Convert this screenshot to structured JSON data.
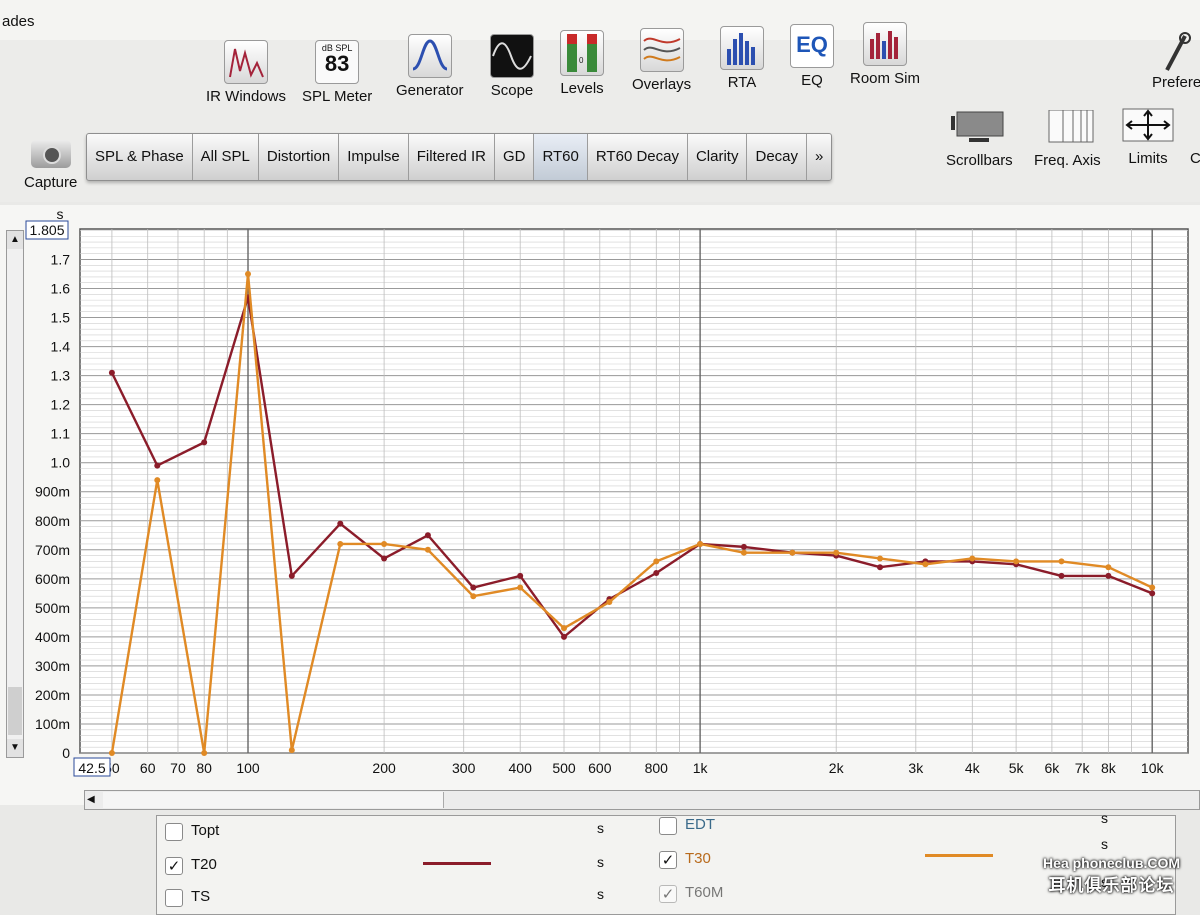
{
  "window": {
    "title_fragment": "ades"
  },
  "toolbar": {
    "items": [
      {
        "label": "IR Windows",
        "icon": "ir-windows-icon"
      },
      {
        "label": "SPL Meter",
        "icon": "spl-meter-icon",
        "meter_unit": "dB SPL",
        "meter_value": "83"
      },
      {
        "label": "Generator",
        "icon": "generator-icon"
      },
      {
        "label": "Scope",
        "icon": "scope-icon"
      },
      {
        "label": "Levels",
        "icon": "levels-icon"
      },
      {
        "label": "Overlays",
        "icon": "overlays-icon"
      },
      {
        "label": "RTA",
        "icon": "rta-icon"
      },
      {
        "label": "EQ",
        "icon": "eq-icon"
      },
      {
        "label": "Room Sim",
        "icon": "room-sim-icon"
      }
    ],
    "preferences_label": "Prefere",
    "capture_label": "Capture"
  },
  "tabs": {
    "items": [
      "SPL & Phase",
      "All SPL",
      "Distortion",
      "Impulse",
      "Filtered IR",
      "GD",
      "RT60",
      "RT60 Decay",
      "Clarity",
      "Decay",
      "»"
    ],
    "active": "RT60"
  },
  "right_tools": [
    {
      "label": "Scrollbars",
      "icon": "scrollbars-icon"
    },
    {
      "label": "Freq. Axis",
      "icon": "freq-axis-icon"
    },
    {
      "label": "Limits",
      "icon": "limits-icon"
    },
    {
      "label": "C",
      "icon": ""
    }
  ],
  "colors": {
    "t20": "#8b1c2a",
    "t30": "#e08a25",
    "accent": "#2a4a9a"
  },
  "chart_data": {
    "type": "line",
    "xscale": "log",
    "xlim": [
      42.5,
      12000
    ],
    "ylim": [
      0,
      1.805
    ],
    "yunit": "s",
    "ymax_label": "1.805",
    "xmin_label": "42.5",
    "x_ticks": [
      {
        "v": 50,
        "l": "50"
      },
      {
        "v": 60,
        "l": "60"
      },
      {
        "v": 70,
        "l": "70"
      },
      {
        "v": 80,
        "l": "80"
      },
      {
        "v": 100,
        "l": "100"
      },
      {
        "v": 200,
        "l": "200"
      },
      {
        "v": 300,
        "l": "300"
      },
      {
        "v": 400,
        "l": "400"
      },
      {
        "v": 500,
        "l": "500"
      },
      {
        "v": 600,
        "l": "600"
      },
      {
        "v": 800,
        "l": "800"
      },
      {
        "v": 1000,
        "l": "1k"
      },
      {
        "v": 2000,
        "l": "2k"
      },
      {
        "v": 3000,
        "l": "3k"
      },
      {
        "v": 4000,
        "l": "4k"
      },
      {
        "v": 5000,
        "l": "5k"
      },
      {
        "v": 6000,
        "l": "6k"
      },
      {
        "v": 7000,
        "l": "7k"
      },
      {
        "v": 8000,
        "l": "8k"
      },
      {
        "v": 10000,
        "l": "10k"
      }
    ],
    "y_ticks": [
      {
        "v": 0,
        "l": "0"
      },
      {
        "v": 0.1,
        "l": "100m"
      },
      {
        "v": 0.2,
        "l": "200m"
      },
      {
        "v": 0.3,
        "l": "300m"
      },
      {
        "v": 0.4,
        "l": "400m"
      },
      {
        "v": 0.5,
        "l": "500m"
      },
      {
        "v": 0.6,
        "l": "600m"
      },
      {
        "v": 0.7,
        "l": "700m"
      },
      {
        "v": 0.8,
        "l": "800m"
      },
      {
        "v": 0.9,
        "l": "900m"
      },
      {
        "v": 1.0,
        "l": "1.0"
      },
      {
        "v": 1.1,
        "l": "1.1"
      },
      {
        "v": 1.2,
        "l": "1.2"
      },
      {
        "v": 1.3,
        "l": "1.3"
      },
      {
        "v": 1.4,
        "l": "1.4"
      },
      {
        "v": 1.5,
        "l": "1.5"
      },
      {
        "v": 1.6,
        "l": "1.6"
      },
      {
        "v": 1.7,
        "l": "1.7"
      }
    ],
    "series": [
      {
        "name": "T20",
        "color": "#8b1c2a",
        "x": [
          50,
          63,
          80,
          100,
          125,
          160,
          200,
          250,
          315,
          400,
          500,
          630,
          800,
          1000,
          1250,
          1600,
          2000,
          2500,
          3150,
          4000,
          5000,
          6300,
          8000,
          10000
        ],
        "y": [
          1.31,
          0.99,
          1.07,
          1.57,
          0.61,
          0.79,
          0.67,
          0.75,
          0.57,
          0.61,
          0.4,
          0.53,
          0.62,
          0.72,
          0.71,
          0.69,
          0.68,
          0.64,
          0.66,
          0.66,
          0.65,
          0.61,
          0.61,
          0.55
        ]
      },
      {
        "name": "T30",
        "color": "#e08a25",
        "x": [
          50,
          63,
          80,
          100,
          125,
          160,
          200,
          250,
          315,
          400,
          500,
          630,
          800,
          1000,
          1250,
          1600,
          2000,
          2500,
          3150,
          4000,
          5000,
          6300,
          8000,
          10000
        ],
        "y": [
          0.0,
          0.94,
          0.0,
          1.65,
          0.01,
          0.72,
          0.72,
          0.7,
          0.54,
          0.57,
          0.43,
          0.52,
          0.66,
          0.72,
          0.69,
          0.69,
          0.69,
          0.67,
          0.65,
          0.67,
          0.66,
          0.66,
          0.64,
          0.57
        ]
      }
    ]
  },
  "legend": {
    "rows": [
      {
        "label": "Topt",
        "checked": false,
        "unit": "s"
      },
      {
        "label": "T20",
        "checked": true,
        "unit": "s"
      },
      {
        "label": "TS",
        "checked": false,
        "unit": "s"
      }
    ],
    "rows_right": [
      {
        "label": "EDT",
        "checked": false,
        "unit": "s"
      },
      {
        "label": "T30",
        "checked": true,
        "unit": "s"
      },
      {
        "label": "T60M",
        "checked": true,
        "unit": "s"
      }
    ]
  },
  "watermark": {
    "line1": "HeadphoneclubCOM",
    "line1_display": "Hea  phonecluʙ.COM",
    "line2": "耳机俱乐部论坛"
  }
}
